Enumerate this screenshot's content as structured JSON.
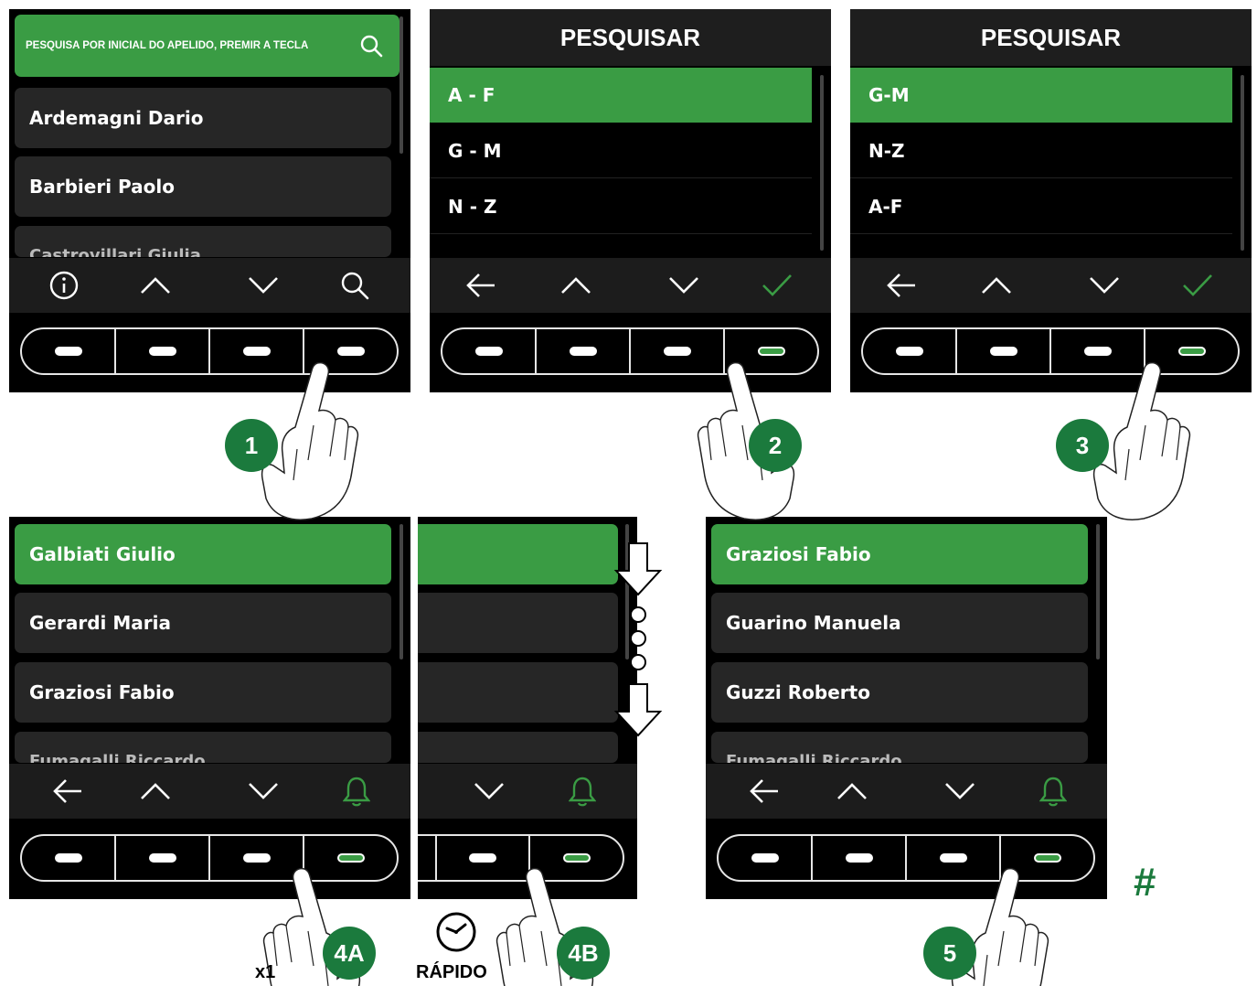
{
  "panel1": {
    "search_label": "PESQUISA POR INICIAL DO APELIDO, PREMIR A TECLA",
    "items": [
      "Ardemagni Dario",
      "Barbieri Paolo",
      "Castrovillari Giulia"
    ]
  },
  "panel2": {
    "title": "PESQUISAR",
    "items": [
      "A - F",
      "G - M",
      "N - Z"
    ]
  },
  "panel3": {
    "title": "PESQUISAR",
    "items": [
      "G-M",
      "N-Z",
      "A-F"
    ]
  },
  "panel4a": {
    "items": [
      "Galbiati Giulio",
      "Gerardi Maria",
      "Graziosi Fabio",
      "Fumagalli Riccardo"
    ]
  },
  "panel5": {
    "items": [
      "Graziosi Fabio",
      "Guarino Manuela",
      "Guzzi Roberto",
      "Fumagalli Riccardo"
    ]
  },
  "steps": [
    "1",
    "2",
    "3",
    "4A",
    "4B",
    "5"
  ],
  "labels": {
    "x1": "x1",
    "rapido": "RÁPIDO",
    "hash": "#"
  },
  "colors": {
    "accent": "#3a9c44",
    "badge": "#1b7a3d",
    "screen": "#000000"
  }
}
